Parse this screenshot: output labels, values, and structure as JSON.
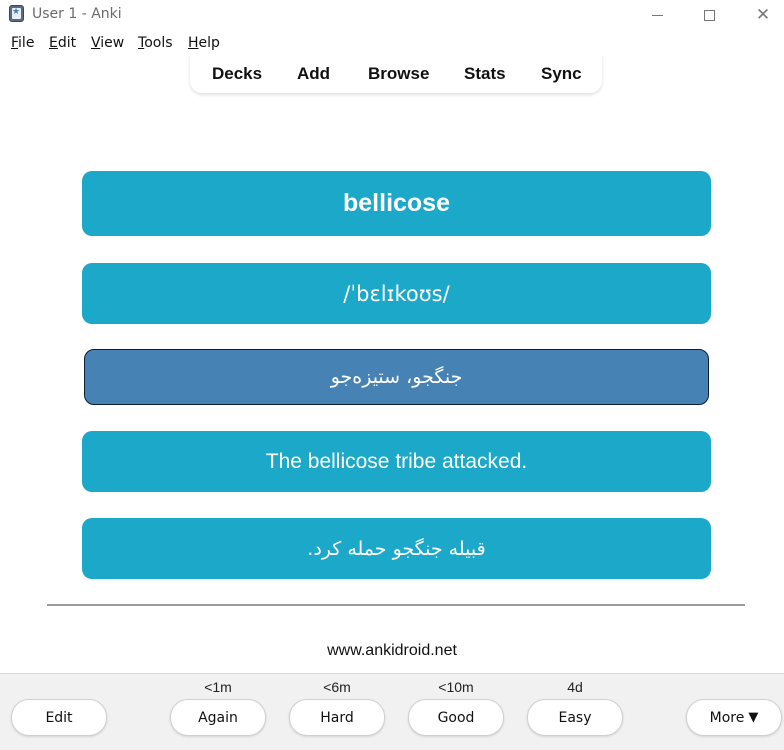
{
  "window": {
    "title": "User 1 - Anki",
    "close_glyph": "✕"
  },
  "menu": {
    "items": [
      {
        "first": "F",
        "rest": "ile"
      },
      {
        "first": "E",
        "rest": "dit"
      },
      {
        "first": "V",
        "rest": "iew"
      },
      {
        "first": "T",
        "rest": "ools"
      },
      {
        "first": "H",
        "rest": "elp"
      }
    ]
  },
  "toolbar": {
    "links": [
      "Decks",
      "Add",
      "Browse",
      "Stats",
      "Sync"
    ]
  },
  "card": {
    "word": "bellicose",
    "ipa": "/ˈbɛlɪkoʊs/",
    "meaning": "جنگجو، ستیزه‌جو",
    "example": "The bellicose tribe attacked.",
    "translation": "قبیله جنگجو حمله کرد."
  },
  "footer": {
    "link": "www.ankidroid.net"
  },
  "answer_bar": {
    "edit_label": "Edit",
    "more_label": "More",
    "more_glyph": "▼",
    "buttons": [
      {
        "label": "Again",
        "interval": "<1m"
      },
      {
        "label": "Hard",
        "interval": "<6m"
      },
      {
        "label": "Good",
        "interval": "<10m"
      },
      {
        "label": "Easy",
        "interval": "4d"
      }
    ]
  },
  "colors": {
    "card": "#1ca8c8",
    "meaning_card": "#4682b4",
    "card_text": "#ffffff"
  }
}
